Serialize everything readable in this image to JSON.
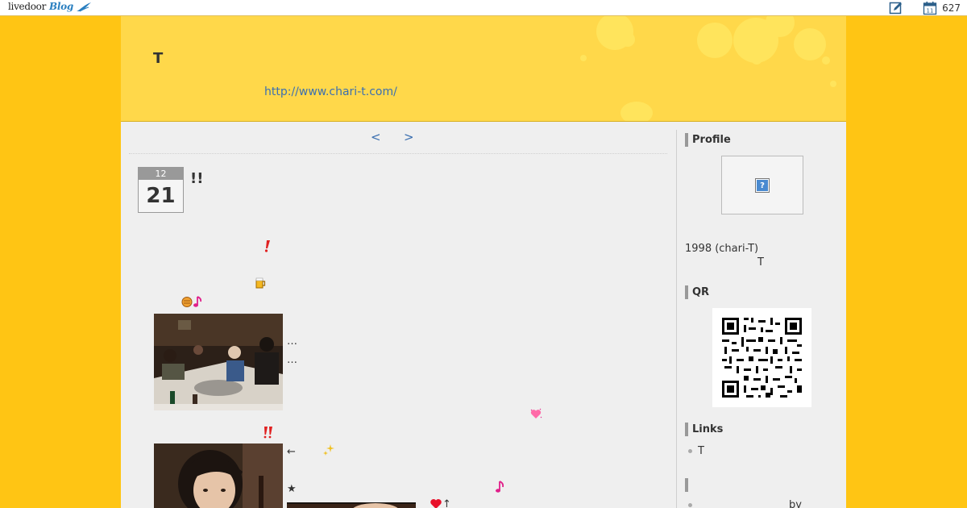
{
  "topbar": {
    "logo_text": "livedoor",
    "logo_blog": "Blog",
    "count": "627"
  },
  "header": {
    "title": "T",
    "url": "http://www.chari-t.com/"
  },
  "pager": {
    "prev": "<",
    "next": ">"
  },
  "entry": {
    "month": "12",
    "day": "21",
    "title": "!!",
    "ellipsis_1": "…",
    "ellipsis_2": "…",
    "arrow_left": "←",
    "star": "★",
    "arrow_up": "↑"
  },
  "sidebar": {
    "profile_heading": "Profile",
    "profile_line1": "1998  (chari-T)",
    "profile_line2": "T",
    "qr_heading": "QR",
    "links_heading": "Links",
    "links": [
      "T"
    ],
    "bottom_text": "by"
  },
  "colors": {
    "background": "#ffc514",
    "header": "#ffd84a",
    "content": "#efefef",
    "link": "#3b6fb0"
  }
}
